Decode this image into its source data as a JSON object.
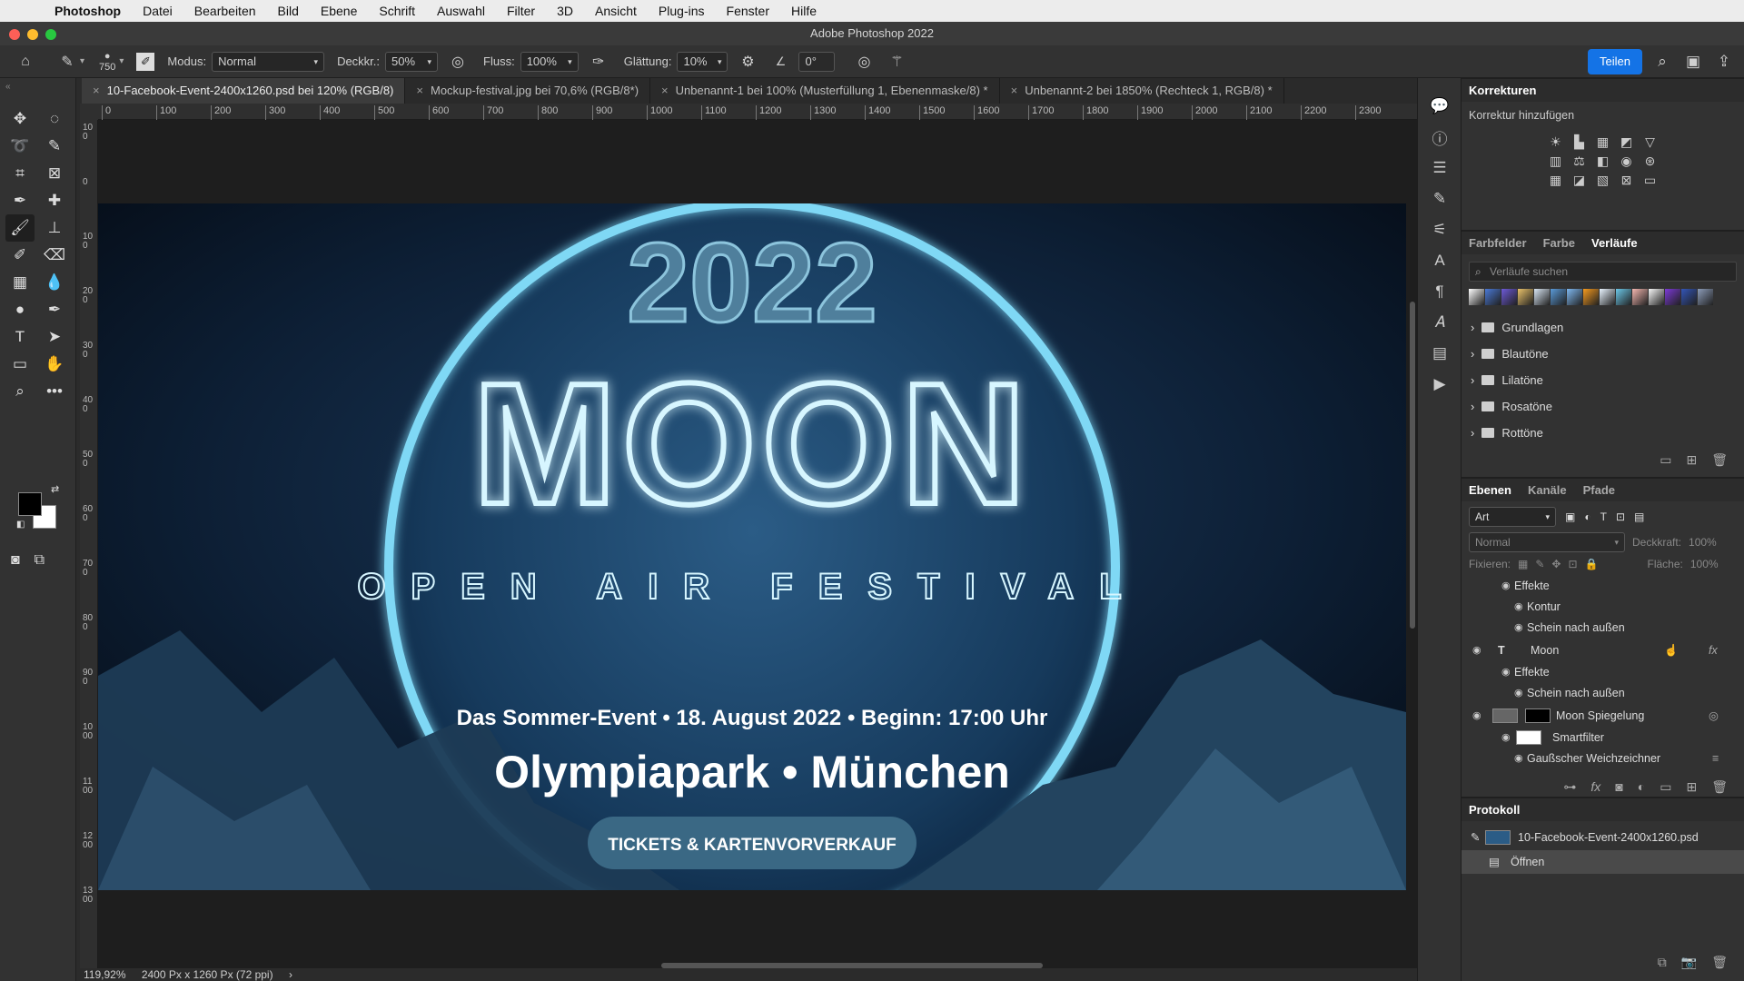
{
  "menubar": {
    "apple": "",
    "items": [
      "Photoshop",
      "Datei",
      "Bearbeiten",
      "Bild",
      "Ebene",
      "Schrift",
      "Auswahl",
      "Filter",
      "3D",
      "Ansicht",
      "Plug-ins",
      "Fenster",
      "Hilfe"
    ]
  },
  "window": {
    "title": "Adobe Photoshop 2022"
  },
  "options": {
    "brush_size": "750",
    "mode_label": "Modus:",
    "mode_value": "Normal",
    "opacity_label": "Deckkr.:",
    "opacity_value": "50%",
    "flow_label": "Fluss:",
    "flow_value": "100%",
    "smoothing_label": "Glättung:",
    "smoothing_value": "10%",
    "angle_value": "0°",
    "share_label": "Teilen"
  },
  "tabs": [
    {
      "label": "10-Facebook-Event-2400x1260.psd bei 120% (RGB/8)",
      "active": true
    },
    {
      "label": "Mockup-festival.jpg bei 70,6% (RGB/8*)"
    },
    {
      "label": "Unbenannt-1 bei 100% (Musterfüllung 1, Ebenenmaske/8) *"
    },
    {
      "label": "Unbenannt-2 bei 1850% (Rechteck 1, RGB/8) *"
    }
  ],
  "ruler": {
    "h_ticks": [
      "0",
      "100",
      "200",
      "300",
      "400",
      "500",
      "600",
      "700",
      "800",
      "900",
      "1000",
      "1100",
      "1200",
      "1300",
      "1400",
      "1500",
      "1600",
      "1700",
      "1800",
      "1900",
      "2000",
      "2100",
      "2200",
      "2300"
    ],
    "v_ticks": [
      "100",
      "0",
      "100",
      "200",
      "300",
      "400",
      "500",
      "600",
      "700",
      "800",
      "900",
      "1000",
      "1100",
      "1200",
      "1300"
    ]
  },
  "artwork": {
    "year": "2022",
    "title": "MOON",
    "subtitle": "OPEN AIR FESTIVAL",
    "event_line": "Das Sommer-Event • 18. August 2022 • Beginn: 17:00 Uhr",
    "location": "Olympiapark • München",
    "cta": "TICKETS & KARTENVORVERKAUF"
  },
  "status": {
    "zoom": "119,92%",
    "doc_info": "2400 Px x 1260 Px (72 ppi)",
    "arrow": "›"
  },
  "korrekturen": {
    "title": "Korrekturen",
    "add_label": "Korrektur hinzufügen"
  },
  "gradients": {
    "tabs": [
      "Farbfelder",
      "Farbe",
      "Verläufe"
    ],
    "active_tab": "Verläufe",
    "search_placeholder": "Verläufe suchen",
    "colors": [
      "#ffffff",
      "#4a79d6",
      "#6d5ad8",
      "#e8c16a",
      "#d8e6f4",
      "#5a9ad8",
      "#7fb8f0",
      "#f59a1f",
      "#e9f4ff",
      "#6cc8e8",
      "#f4b7b0",
      "#f7f7f7",
      "#7c3ad6",
      "#3355b8",
      "#8b9bb8"
    ],
    "folders": [
      "Grundlagen",
      "Blautöne",
      "Lilatöne",
      "Rosatöne",
      "Rottöne"
    ]
  },
  "layers": {
    "tabs": [
      "Ebenen",
      "Kanäle",
      "Pfade"
    ],
    "filter_label": "Art",
    "blend_mode": "Normal",
    "opacity_label": "Deckkraft:",
    "opacity_value": "100%",
    "lock_label": "Fixieren:",
    "fill_label": "Fläche:",
    "fill_value": "100%",
    "rows": [
      {
        "label": "Effekte",
        "indent": 44
      },
      {
        "label": "Kontur",
        "indent": 58
      },
      {
        "label": "Schein nach außen",
        "indent": 58
      },
      {
        "label": "Moon",
        "indent": 44,
        "type": "T",
        "fx": "fx"
      },
      {
        "label": "Effekte",
        "indent": 44
      },
      {
        "label": "Schein nach außen",
        "indent": 58
      },
      {
        "label": "Moon Spiegelung",
        "indent": 96,
        "thumb": true
      },
      {
        "label": "Smartfilter",
        "indent": 96
      },
      {
        "label": "Gaußscher Weichzeichner",
        "indent": 58
      }
    ]
  },
  "protokoll": {
    "title": "Protokoll",
    "rows": [
      "10-Facebook-Event-2400x1260.psd",
      "Öffnen"
    ]
  }
}
